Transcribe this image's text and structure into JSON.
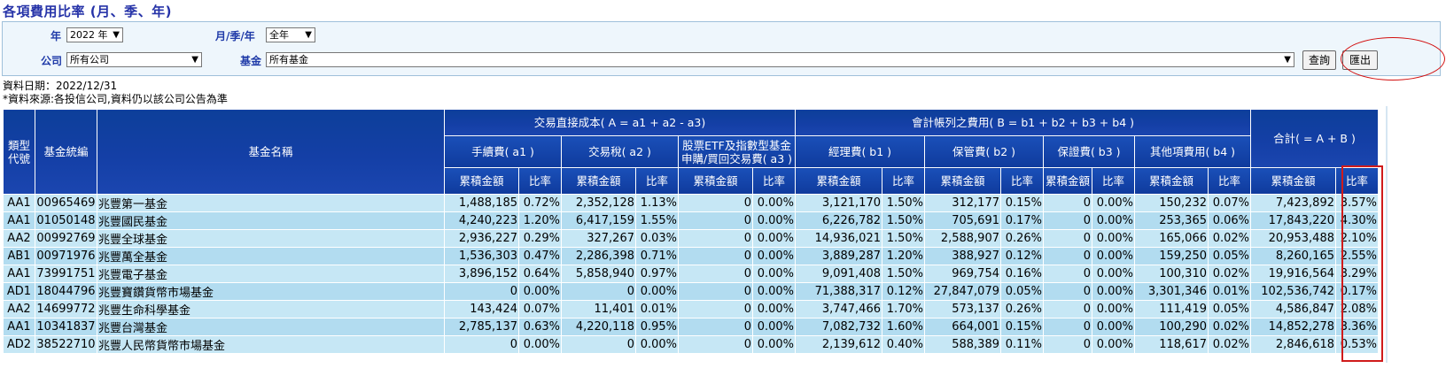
{
  "page": {
    "title": "各項費用比率 (月、季、年)"
  },
  "filters": {
    "year_label": "年",
    "year_value": "2022 年",
    "period_label": "月/季/年",
    "period_value": "全年",
    "company_label": "公司",
    "company_value": "所有公司",
    "fund_label": "基金",
    "fund_value": "所有基金",
    "query_button": "查詢",
    "export_button": "匯出"
  },
  "info": {
    "data_date": "資料日期：2022/12/31",
    "source_note": "*資料來源:各投信公司,資料仍以該公司公告為準"
  },
  "headers": {
    "type_code": "類型代號",
    "fund_code": "基金統編",
    "fund_name": "基金名稱",
    "group_a": "交易直接成本( A = a1 + a2 - a3)",
    "group_b": "會計帳列之費用( B = b1 + b2 + b3 + b4 )",
    "total": "合計( = A + B )",
    "a1": "手續費( a1 )",
    "a2": "交易稅( a2 )",
    "a3": "股票ETF及指數型基金申購/買回交易費( a3 )",
    "b1": "經理費( b1 )",
    "b2": "保管費( b2 )",
    "b3": "保證費( b3 )",
    "b4": "其他項費用( b4 )",
    "amount": "累積金額",
    "rate": "比率"
  },
  "rows": [
    {
      "type": "AA1",
      "code": "00965469",
      "name": "兆豐第一基金",
      "a1": "1,488,185",
      "a1r": "0.72%",
      "a2": "2,352,128",
      "a2r": "1.13%",
      "a3": "0",
      "a3r": "0.00%",
      "b1": "3,121,170",
      "b1r": "1.50%",
      "b2": "312,177",
      "b2r": "0.15%",
      "b3": "0",
      "b3r": "0.00%",
      "b4": "150,232",
      "b4r": "0.07%",
      "t": "7,423,892",
      "tr": "3.57%"
    },
    {
      "type": "AA1",
      "code": "01050148",
      "name": "兆豐國民基金",
      "a1": "4,240,223",
      "a1r": "1.20%",
      "a2": "6,417,159",
      "a2r": "1.55%",
      "a3": "0",
      "a3r": "0.00%",
      "b1": "6,226,782",
      "b1r": "1.50%",
      "b2": "705,691",
      "b2r": "0.17%",
      "b3": "0",
      "b3r": "0.00%",
      "b4": "253,365",
      "b4r": "0.06%",
      "t": "17,843,220",
      "tr": "4.30%"
    },
    {
      "type": "AA2",
      "code": "00992769",
      "name": "兆豐全球基金",
      "a1": "2,936,227",
      "a1r": "0.29%",
      "a2": "327,267",
      "a2r": "0.03%",
      "a3": "0",
      "a3r": "0.00%",
      "b1": "14,936,021",
      "b1r": "1.50%",
      "b2": "2,588,907",
      "b2r": "0.26%",
      "b3": "0",
      "b3r": "0.00%",
      "b4": "165,066",
      "b4r": "0.02%",
      "t": "20,953,488",
      "tr": "2.10%"
    },
    {
      "type": "AB1",
      "code": "00971976",
      "name": "兆豐萬全基金",
      "a1": "1,536,303",
      "a1r": "0.47%",
      "a2": "2,286,398",
      "a2r": "0.71%",
      "a3": "0",
      "a3r": "0.00%",
      "b1": "3,889,287",
      "b1r": "1.20%",
      "b2": "388,927",
      "b2r": "0.12%",
      "b3": "0",
      "b3r": "0.00%",
      "b4": "159,250",
      "b4r": "0.05%",
      "t": "8,260,165",
      "tr": "2.55%"
    },
    {
      "type": "AA1",
      "code": "73991751",
      "name": "兆豐電子基金",
      "a1": "3,896,152",
      "a1r": "0.64%",
      "a2": "5,858,940",
      "a2r": "0.97%",
      "a3": "0",
      "a3r": "0.00%",
      "b1": "9,091,408",
      "b1r": "1.50%",
      "b2": "969,754",
      "b2r": "0.16%",
      "b3": "0",
      "b3r": "0.00%",
      "b4": "100,310",
      "b4r": "0.02%",
      "t": "19,916,564",
      "tr": "3.29%"
    },
    {
      "type": "AD1",
      "code": "18044796",
      "name": "兆豐寶鑽貨幣市場基金",
      "a1": "0",
      "a1r": "0.00%",
      "a2": "0",
      "a2r": "0.00%",
      "a3": "0",
      "a3r": "0.00%",
      "b1": "71,388,317",
      "b1r": "0.12%",
      "b2": "27,847,079",
      "b2r": "0.05%",
      "b3": "0",
      "b3r": "0.00%",
      "b4": "3,301,346",
      "b4r": "0.01%",
      "t": "102,536,742",
      "tr": "0.17%"
    },
    {
      "type": "AA2",
      "code": "14699772",
      "name": "兆豐生命科學基金",
      "a1": "143,424",
      "a1r": "0.07%",
      "a2": "11,401",
      "a2r": "0.01%",
      "a3": "0",
      "a3r": "0.00%",
      "b1": "3,747,466",
      "b1r": "1.70%",
      "b2": "573,137",
      "b2r": "0.26%",
      "b3": "0",
      "b3r": "0.00%",
      "b4": "111,419",
      "b4r": "0.05%",
      "t": "4,586,847",
      "tr": "2.08%"
    },
    {
      "type": "AA1",
      "code": "10341837",
      "name": "兆豐台灣基金",
      "a1": "2,785,137",
      "a1r": "0.63%",
      "a2": "4,220,118",
      "a2r": "0.95%",
      "a3": "0",
      "a3r": "0.00%",
      "b1": "7,082,732",
      "b1r": "1.60%",
      "b2": "664,001",
      "b2r": "0.15%",
      "b3": "0",
      "b3r": "0.00%",
      "b4": "100,290",
      "b4r": "0.02%",
      "t": "14,852,278",
      "tr": "3.36%"
    },
    {
      "type": "AD2",
      "code": "38522710",
      "name": "兆豐人民幣貨幣市場基金",
      "a1": "0",
      "a1r": "0.00%",
      "a2": "0",
      "a2r": "0.00%",
      "a3": "0",
      "a3r": "0.00%",
      "b1": "2,139,612",
      "b1r": "0.40%",
      "b2": "588,389",
      "b2r": "0.11%",
      "b3": "0",
      "b3r": "0.00%",
      "b4": "118,617",
      "b4r": "0.02%",
      "t": "2,846,618",
      "tr": "0.53%"
    }
  ]
}
